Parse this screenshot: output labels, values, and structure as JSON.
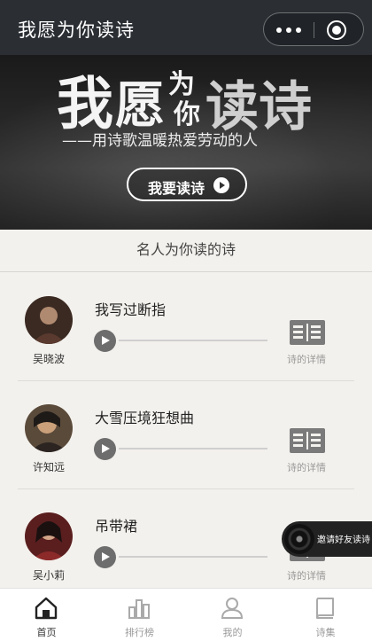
{
  "header": {
    "title": "我愿为你读诗"
  },
  "banner": {
    "headline_1": "我",
    "headline_2": "愿",
    "headline_3": "为",
    "headline_4": "你",
    "headline_5": "读诗",
    "subtitle": "——用诗歌温暖热爱劳动的人",
    "button_label": "我要读诗"
  },
  "section": {
    "title": "名人为你读的诗"
  },
  "poems": [
    {
      "title": "我写过断指",
      "author": "吴晓波",
      "detail_label": "诗的详情",
      "avatar_color": "#6b4a3a"
    },
    {
      "title": "大雪压境狂想曲",
      "author": "许知远",
      "detail_label": "诗的详情",
      "avatar_color": "#8a6a50"
    },
    {
      "title": "吊带裙",
      "author": "吴小莉",
      "detail_label": "诗的详情",
      "avatar_color": "#7a2a2a"
    }
  ],
  "invite": {
    "label": "邀请好友读诗"
  },
  "tabbar": {
    "items": [
      {
        "label": "首页",
        "icon": "home-icon",
        "active": true
      },
      {
        "label": "排行榜",
        "icon": "chart-icon",
        "active": false
      },
      {
        "label": "我的",
        "icon": "user-icon",
        "active": false
      },
      {
        "label": "诗集",
        "icon": "book-icon",
        "active": false
      }
    ]
  },
  "colors": {
    "topbar": "#2b2f34",
    "page_bg": "#f3f1ed",
    "play_button": "#6d6d6d"
  }
}
